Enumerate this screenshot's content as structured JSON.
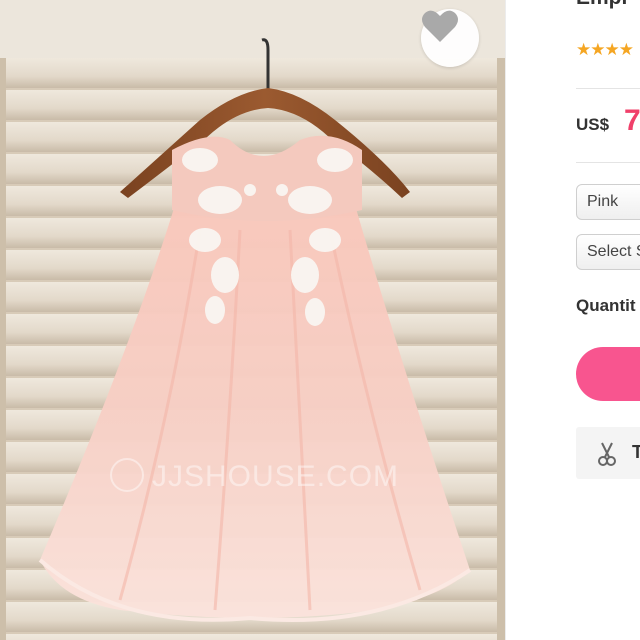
{
  "product": {
    "title": "Empi",
    "rating_stars": "★★★★",
    "price_currency": "US$",
    "price_value": "7",
    "watermark_text": "JJSHOUSE.COM"
  },
  "selectors": {
    "color_value": "Pink",
    "size_value": "Select S"
  },
  "quantity": {
    "label": "Quantit"
  },
  "buttons": {
    "add_to_cart_label": "",
    "tool_label": "T"
  },
  "colors": {
    "price": "#f0406a",
    "accent_button": "#f8558f",
    "stars": "#f5a623"
  }
}
